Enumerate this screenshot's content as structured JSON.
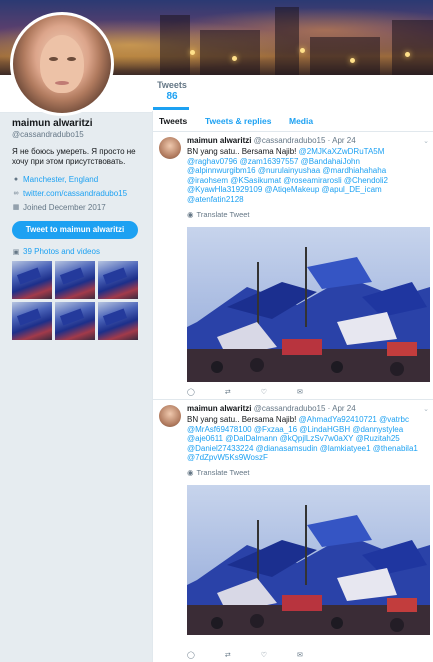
{
  "profile": {
    "name": "maimun alwaritzi",
    "handle": "@cassandradubo15",
    "bio": "Я не боюсь умереть. Я просто не хочу при этом присутствовать.",
    "location": "Manchester, England",
    "website": "twitter.com/cassandradubo15",
    "joined": "Joined December 2017",
    "tweet_button": "Tweet to maimun alwaritzi",
    "photos_link": "39 Photos and videos"
  },
  "stats": {
    "tweets_label": "Tweets",
    "tweets_count": "86"
  },
  "tabs": [
    "Tweets",
    "Tweets & replies",
    "Media"
  ],
  "tweets": [
    {
      "name": "maimun alwaritzi",
      "handle": "@cassandradubo15",
      "date": "· Apr 24",
      "text_plain": "BN yang satu.. Bersama Najib!",
      "text_links": "@2MJKaXZwDRuTA5M @raghav0796 @zam16397557 @BandahaiJohn @alpinnwurgibm16 @nurulainyushaa @mardhiahahaha @iraohsem @KSasikumat @roseamirarosli @Chendoli2 @KyawHla31929109 @AtiqeMakeup @apul_DE_icam @atenfatin2128",
      "translate": "Translate Tweet"
    },
    {
      "name": "maimun alwaritzi",
      "handle": "@cassandradubo15",
      "date": "· Apr 24",
      "text_plain": "BN yang satu.. Bersama Najib!",
      "text_links": "@AhmadYa92410721 @vatrbc @MrAsf69478100 @Fxzaa_16 @LindaHGBH @dannystylea @aje0611 @DalDalmann @kQpjlLzSv7w0aXY @Ruzitah25 @Daniel27433224 @dianasamsudin @lamkiatyee1 @thenabila1 @7dZpvW5Ks9WoszF",
      "translate": "Translate Tweet"
    }
  ],
  "colors": {
    "accent": "#1da1f2",
    "text": "#14171a",
    "muted": "#657786",
    "background": "#e6ecf0"
  },
  "icons": [
    "location-icon",
    "link-icon",
    "calendar-icon",
    "photo-icon",
    "reply-icon",
    "retweet-icon",
    "like-icon",
    "message-icon",
    "globe-icon",
    "chevron-down-icon"
  ]
}
